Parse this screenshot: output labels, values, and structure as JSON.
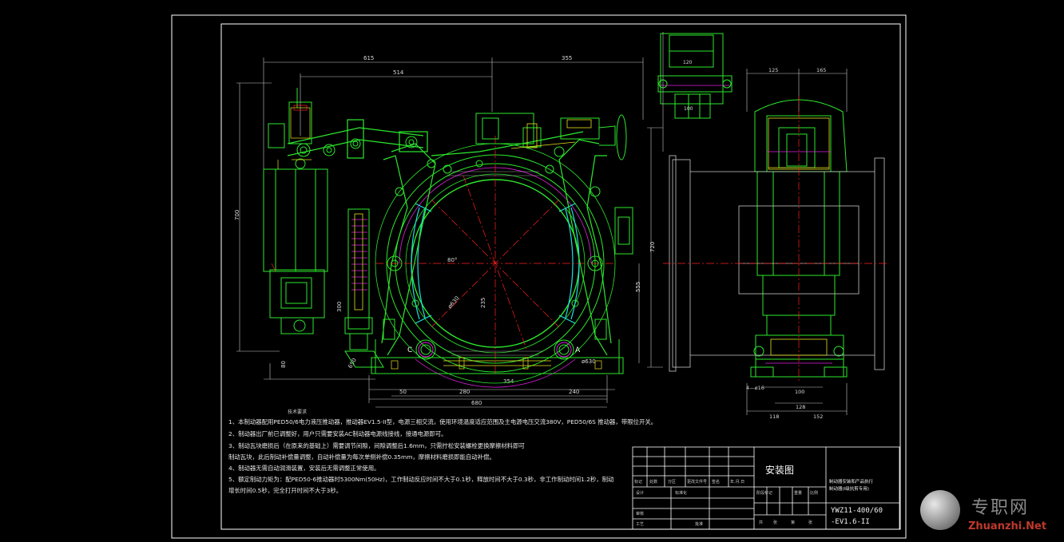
{
  "drawing": {
    "notes_heading": "技术要求",
    "notes": [
      "1、本制动器配用PED50/6电力液压推动器，推动器EV1.5-II型，电源三相交流，使用环境温度适应范围及主电源电压交流380V，PED50/6S 推动器，带限位开关。",
      "2、制动器出厂前已调整好，用户只需要安装AC制动器电源线接线，接通电源即可。",
      "3、制动瓦块磨损后（在原来的基础上）需要调节间隙，间隙调整后1.6mm，只需拧松安装螺栓更换摩擦材料即可",
      "   制动瓦块，此后制动补偿量调整，自动补偿量为每次单侧补偿0.35mm，摩擦材料磨损即能自动补偿。",
      "4、制动器无需自动润滑装置，安装后无需调整正常使用。",
      "5、额定制动力矩为：配PED50-6推动器时5300Nm(50Hz)，工作制动反应时间不大于0.1秒，释放时间不大于0.3秒，非工作制动时间1.2秒，制动",
      "   增长时间0.5秒，完全打开时间不大于3秒。"
    ],
    "dims": {
      "d615": "615",
      "d355": "355",
      "d514": "514",
      "d125": "125",
      "d165": "165",
      "d700": "700",
      "d720": "720",
      "d555": "555",
      "d300": "300",
      "d80": "80",
      "d650": "650",
      "d50": "50",
      "d280": "280",
      "d354": "354",
      "d240": "240",
      "d630": "630",
      "d680": "680",
      "d118": "118",
      "d128": "128",
      "d152": "152",
      "d100": "100",
      "d120": "120",
      "hole": "4—ø16",
      "dia": "ø630",
      "ang": "80°",
      "label_c": "C",
      "label_a": "A"
    }
  },
  "title_block": {
    "title": "安装图",
    "description_1": "制动器安装和产品执行",
    "description_2": "制动器(I级抗剪专用)",
    "code_1": "YWZ11-400/60",
    "code_2": "-EV1.6-II",
    "row_labels": [
      "标记",
      "处数",
      "分区",
      "更改文件号",
      "签名",
      "年.月.日"
    ],
    "designer_label": "设计",
    "std_label": "标准化",
    "checker_label": "审核",
    "approve_label": "批准",
    "process_label": "工艺",
    "stage_labels": [
      "阶段标记",
      "重量",
      "比例"
    ],
    "sheet_labels": [
      "共",
      "张",
      "第",
      "张"
    ]
  },
  "watermark": {
    "site_cn": "专职网",
    "site_en": "Zhuanzhi.Net"
  },
  "colors": {
    "background": "#000000",
    "frame": "#ffffff",
    "body_green": "#2de82d",
    "center_red": "#ff2020",
    "dim_gray": "#c8c8c8",
    "shoe_cyan": "#20e0e0",
    "hydraulic_yellow": "#e8e020",
    "accent_magenta": "#e020e0",
    "text_white": "#f0f0f0"
  }
}
